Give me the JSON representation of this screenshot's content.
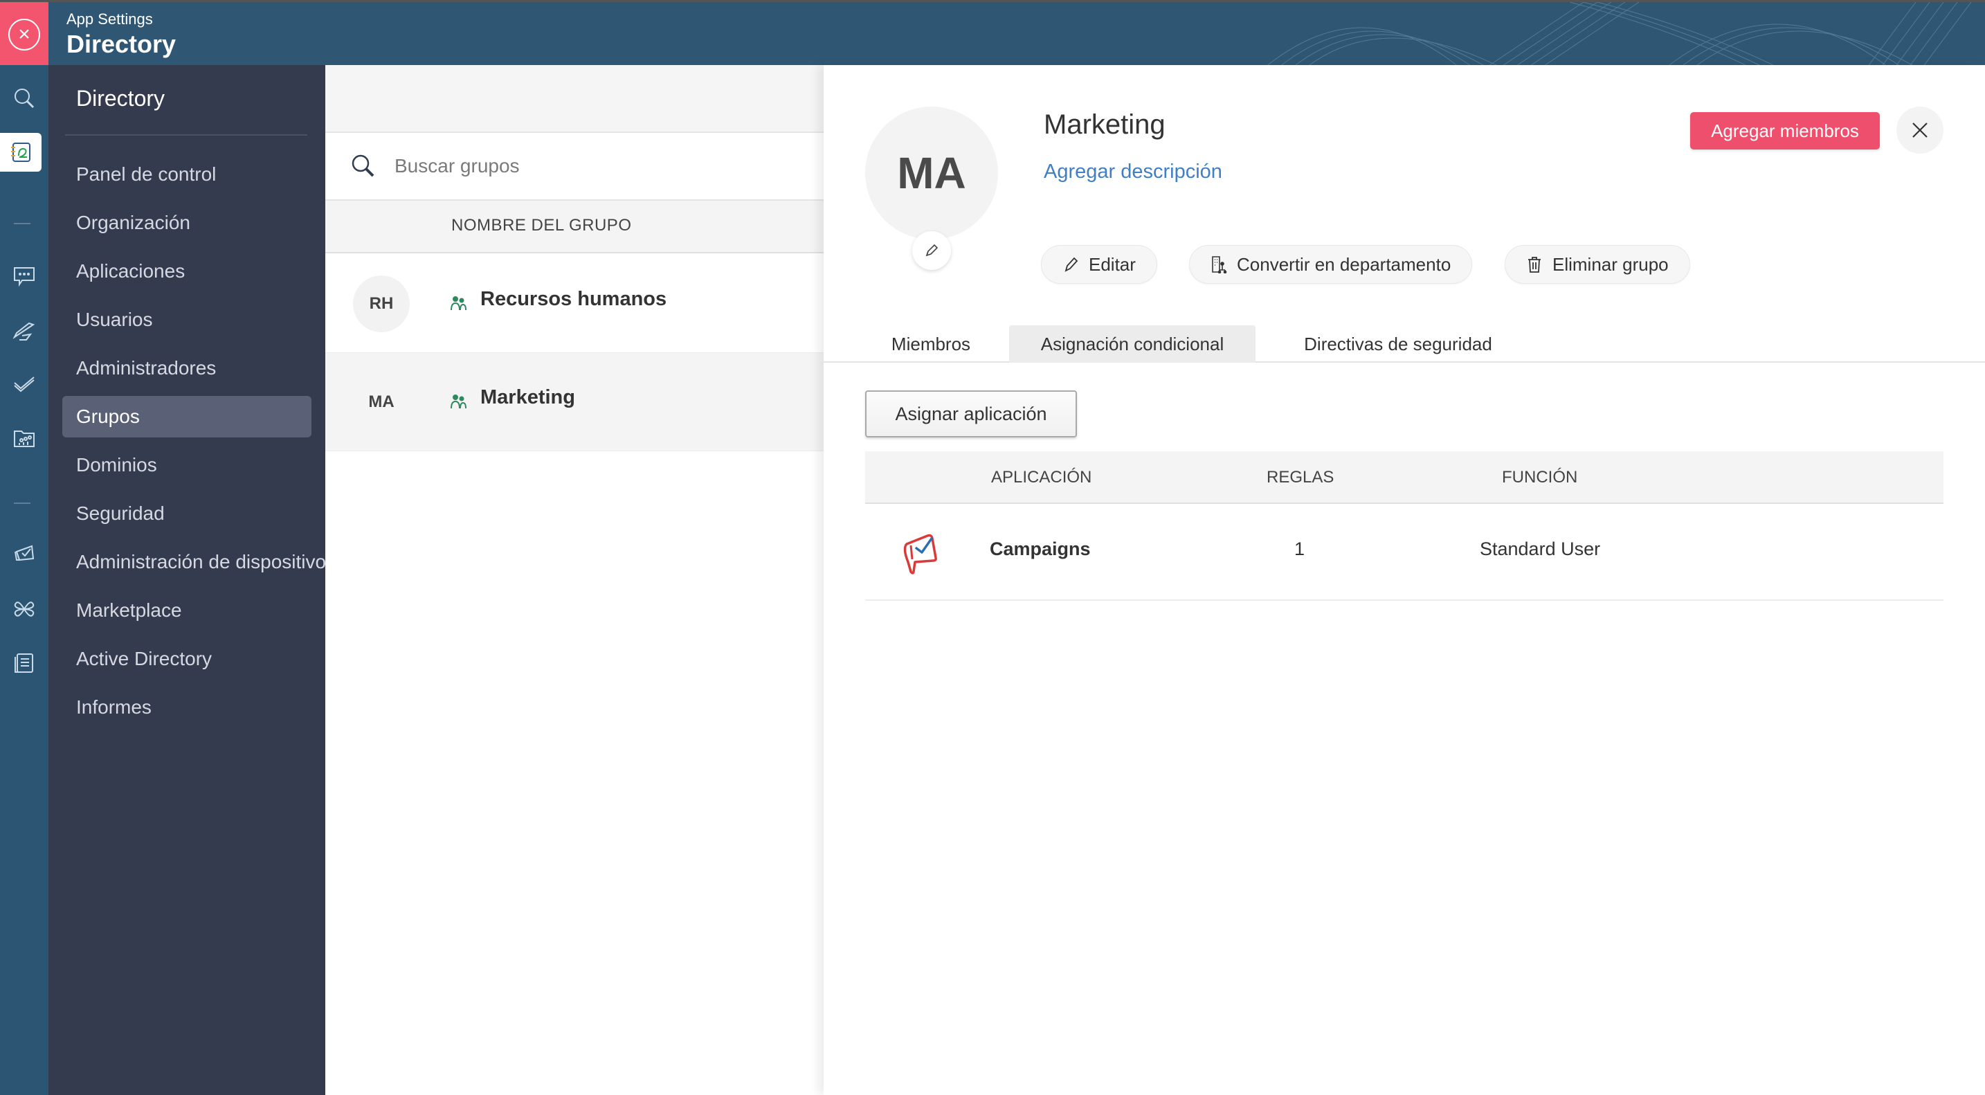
{
  "header": {
    "subtitle": "App Settings",
    "title": "Directory",
    "close_icon": "close-circle-icon"
  },
  "rail": {
    "icons": [
      "search-icon",
      "directory-app-icon",
      "separator",
      "chat-icon",
      "plane-icon",
      "check-icon",
      "folder-users-icon",
      "separator",
      "megaphone-icon",
      "clover-icon",
      "documents-icon"
    ]
  },
  "nav": {
    "title": "Directory",
    "items": [
      {
        "label": "Panel de control"
      },
      {
        "label": "Organización"
      },
      {
        "label": "Aplicaciones"
      },
      {
        "label": "Usuarios"
      },
      {
        "label": "Administradores"
      },
      {
        "label": "Grupos",
        "active": true
      },
      {
        "label": "Dominios"
      },
      {
        "label": "Seguridad"
      },
      {
        "label": "Administración de dispositivos"
      },
      {
        "label": "Marketplace"
      },
      {
        "label": "Active Directory"
      },
      {
        "label": "Informes"
      }
    ]
  },
  "groups": {
    "search_placeholder": "Buscar grupos",
    "column_header": "NOMBRE DEL GRUPO",
    "rows": [
      {
        "initials": "RH",
        "name": "Recursos humanos",
        "selected": false
      },
      {
        "initials": "MA",
        "name": "Marketing",
        "selected": true
      }
    ]
  },
  "detail": {
    "initials": "MA",
    "title": "Marketing",
    "add_description": "Agregar descripción",
    "add_members": "Agregar miembros",
    "actions": {
      "edit": "Editar",
      "convert": "Convertir en departamento",
      "delete": "Eliminar grupo"
    },
    "tabs": [
      {
        "label": "Miembros"
      },
      {
        "label": "Asignación condicional",
        "active": true
      },
      {
        "label": "Directivas de seguridad"
      }
    ],
    "assign_button": "Asignar aplicación",
    "table": {
      "headers": {
        "app": "APLICACIÓN",
        "rules": "REGLAS",
        "role": "FUNCIÓN"
      },
      "rows": [
        {
          "app": "Campaigns",
          "rules": "1",
          "role": "Standard User",
          "icon": "campaigns-logo-icon"
        }
      ]
    }
  },
  "colors": {
    "accent": "#ee4f6d",
    "link": "#3f7fc6",
    "header_bg": "#2f5774",
    "nav_bg": "#353b4e",
    "nav_active": "#5a6075",
    "group_icon": "#2e8a5e"
  }
}
